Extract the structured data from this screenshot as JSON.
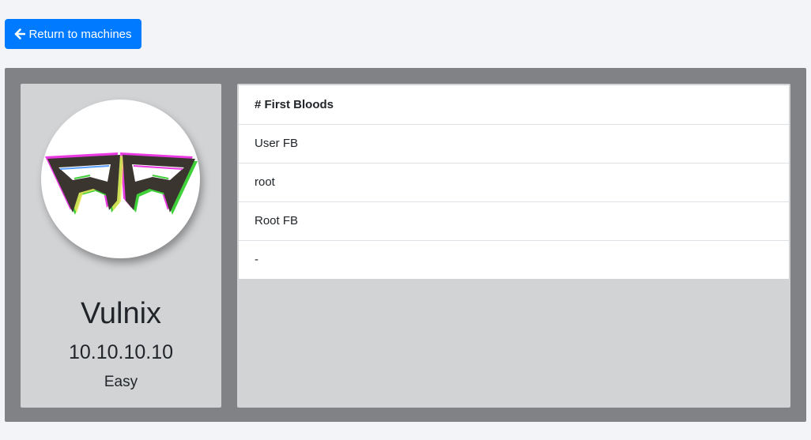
{
  "nav": {
    "return_label": "Return to machines",
    "return_icon": "arrow-left-icon"
  },
  "machine": {
    "name": "Vulnix",
    "ip": "10.10.10.10",
    "difficulty": "Easy",
    "avatar_icon": "glitch-mask-logo"
  },
  "first_bloods": {
    "header": "# First Bloods",
    "rows": [
      "User FB",
      "root",
      "Root FB",
      "-"
    ]
  },
  "colors": {
    "primary": "#007bff",
    "page_bg": "#f3f4f7",
    "panel_bg": "#808285",
    "card_bg": "#d2d3d5"
  }
}
